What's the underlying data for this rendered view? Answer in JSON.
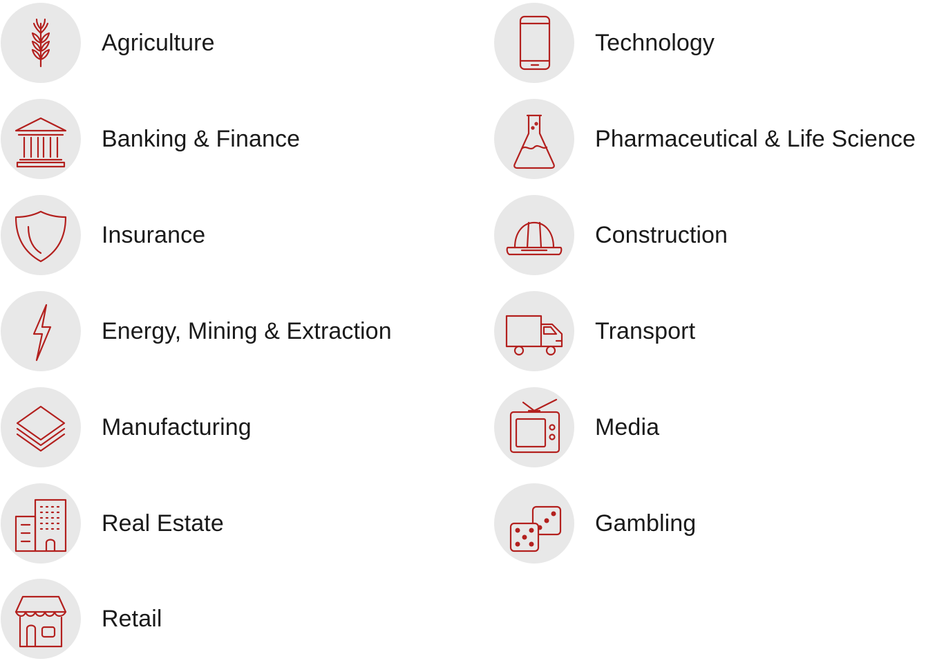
{
  "accent_color": "#b3201e",
  "circle_color": "#e8e8e8",
  "industries": {
    "agriculture": {
      "label": "Agriculture",
      "icon": "wheat-icon"
    },
    "banking": {
      "label": "Banking & Finance",
      "icon": "bank-icon"
    },
    "insurance": {
      "label": "Insurance",
      "icon": "shield-icon"
    },
    "energy": {
      "label": "Energy, Mining & Extraction",
      "icon": "lightning-icon"
    },
    "manufacturing": {
      "label": "Manufacturing",
      "icon": "layers-icon"
    },
    "real_estate": {
      "label": "Real Estate",
      "icon": "building-icon"
    },
    "retail": {
      "label": "Retail",
      "icon": "storefront-icon"
    },
    "technology": {
      "label": "Technology",
      "icon": "smartphone-icon"
    },
    "pharma": {
      "label": "Pharmaceutical & Life Science",
      "icon": "flask-icon"
    },
    "construction": {
      "label": "Construction",
      "icon": "hard-hat-icon"
    },
    "transport": {
      "label": "Transport",
      "icon": "truck-icon"
    },
    "media": {
      "label": "Media",
      "icon": "television-icon"
    },
    "gambling": {
      "label": "Gambling",
      "icon": "dice-icon"
    }
  }
}
